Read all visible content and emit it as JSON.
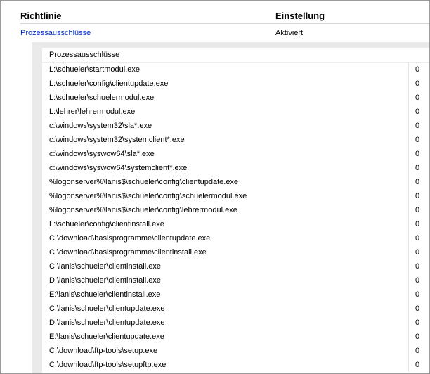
{
  "columns": {
    "left": "Richtlinie",
    "right": "Einstellung"
  },
  "policy": {
    "name": "Prozessausschlüsse",
    "value": "Aktiviert"
  },
  "table": {
    "title": "Prozessausschlüsse",
    "rows": [
      {
        "path": "L:\\schueler\\startmodul.exe",
        "value": "0"
      },
      {
        "path": "L:\\schueler\\config\\clientupdate.exe",
        "value": "0"
      },
      {
        "path": "L:\\schueler\\schuelermodul.exe",
        "value": "0"
      },
      {
        "path": "L:\\lehrer\\lehrermodul.exe",
        "value": "0"
      },
      {
        "path": "c:\\windows\\system32\\sla*.exe",
        "value": "0"
      },
      {
        "path": "c:\\windows\\system32\\systemclient*.exe",
        "value": "0"
      },
      {
        "path": "c:\\windows\\syswow64\\sla*.exe",
        "value": "0"
      },
      {
        "path": "c:\\windows\\syswow64\\systemclient*.exe",
        "value": "0"
      },
      {
        "path": "%logonserver%\\lanis$\\schueler\\config\\clientupdate.exe",
        "value": "0"
      },
      {
        "path": "%logonserver%\\lanis$\\schueler\\config\\schuelermodul.exe",
        "value": "0"
      },
      {
        "path": "%logonserver%\\lanis$\\schueler\\config\\lehrermodul.exe",
        "value": "0"
      },
      {
        "path": "L:\\schueler\\config\\clientinstall.exe",
        "value": "0"
      },
      {
        "path": "C:\\download\\basisprogramme\\clientupdate.exe",
        "value": "0"
      },
      {
        "path": "C:\\download\\basisprogramme\\clientinstall.exe",
        "value": "0"
      },
      {
        "path": "C:\\lanis\\schueler\\clientinstall.exe",
        "value": "0"
      },
      {
        "path": "D:\\lanis\\schueler\\clientinstall.exe",
        "value": "0"
      },
      {
        "path": "E:\\lanis\\schueler\\clientinstall.exe",
        "value": "0"
      },
      {
        "path": "C:\\lanis\\schueler\\clientupdate.exe",
        "value": "0"
      },
      {
        "path": "D:\\lanis\\schueler\\clientupdate.exe",
        "value": "0"
      },
      {
        "path": "E:\\lanis\\schueler\\clientupdate.exe",
        "value": "0"
      },
      {
        "path": "C:\\download\\ftp-tools\\setup.exe",
        "value": "0"
      },
      {
        "path": "C:\\download\\ftp-tools\\setupftp.exe",
        "value": "0"
      }
    ]
  }
}
